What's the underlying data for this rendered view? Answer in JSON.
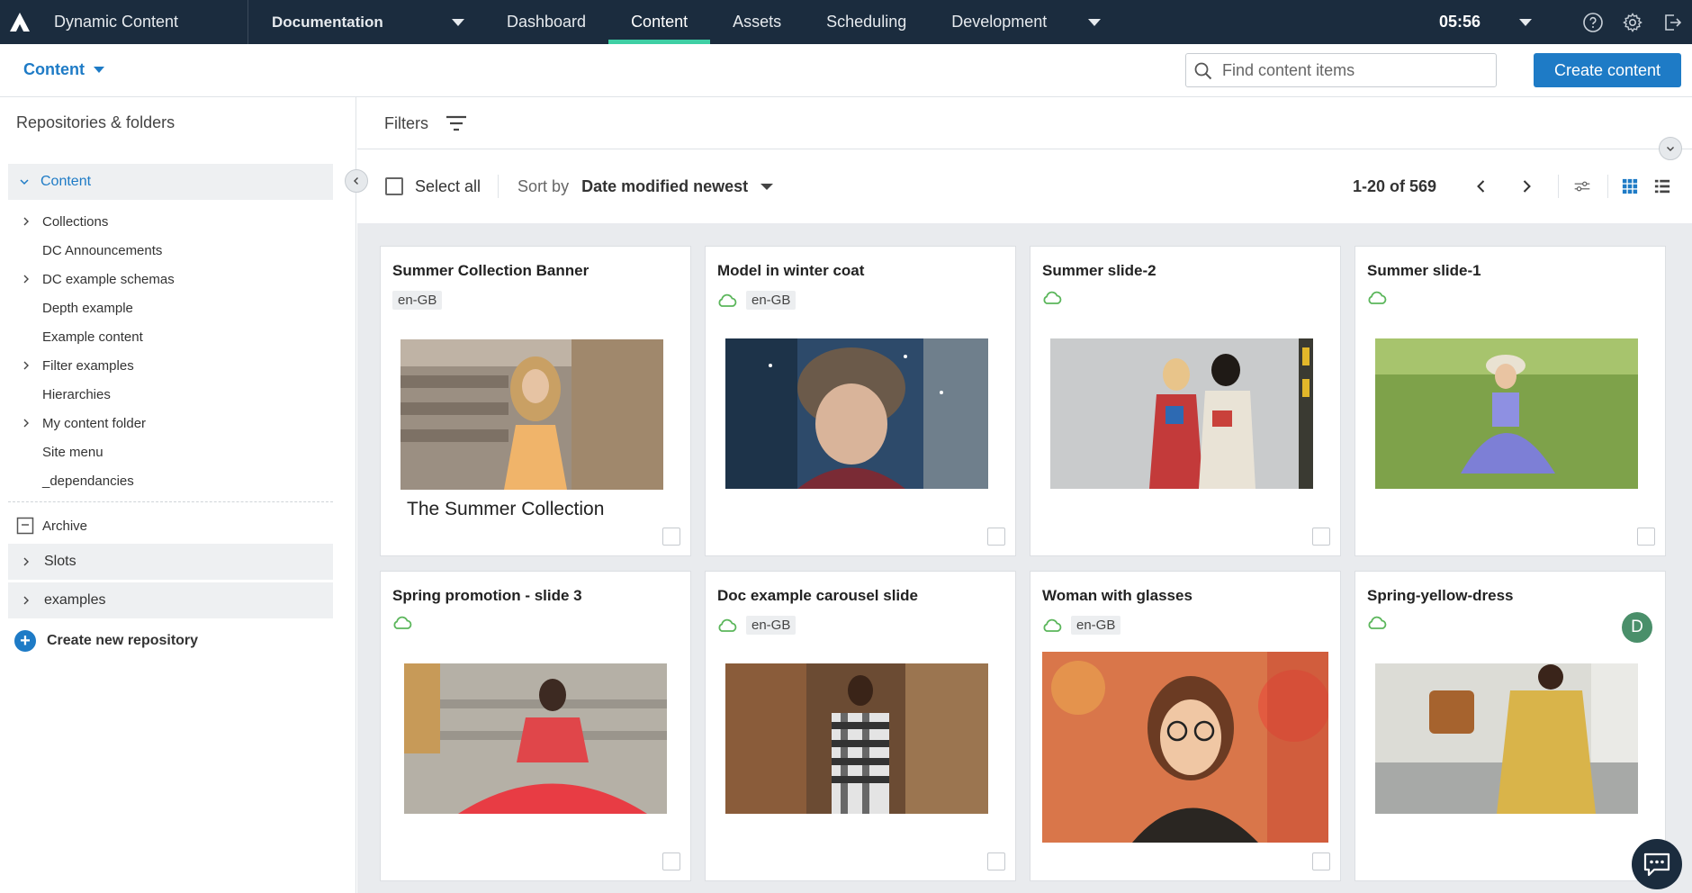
{
  "app": {
    "name": "Dynamic Content",
    "hub": "Documentation",
    "time": "05:56"
  },
  "nav": {
    "tabs": [
      {
        "label": "Dashboard"
      },
      {
        "label": "Content"
      },
      {
        "label": "Assets"
      },
      {
        "label": "Scheduling"
      },
      {
        "label": "Development"
      }
    ],
    "active_tab": "Content"
  },
  "subbar": {
    "breadcrumb": "Content",
    "search_placeholder": "Find content items",
    "create_label": "Create content"
  },
  "sidebar": {
    "title": "Repositories & folders",
    "repository": "Content",
    "folders": [
      {
        "label": "Collections",
        "expandable": true
      },
      {
        "label": "DC Announcements",
        "expandable": false
      },
      {
        "label": "DC example schemas",
        "expandable": true
      },
      {
        "label": "Depth example",
        "expandable": false
      },
      {
        "label": "Example content",
        "expandable": false
      },
      {
        "label": "Filter examples",
        "expandable": true
      },
      {
        "label": "Hierarchies",
        "expandable": false
      },
      {
        "label": "My content folder",
        "expandable": true
      },
      {
        "label": "Site menu",
        "expandable": false
      },
      {
        "label": "_dependancies",
        "expandable": false
      }
    ],
    "archive": "Archive",
    "other_repos": [
      {
        "label": "Slots"
      },
      {
        "label": "examples"
      }
    ],
    "create_repo": "Create new repository"
  },
  "main": {
    "filters_label": "Filters",
    "select_all": "Select all",
    "sort_by": "Sort by",
    "sort_value": "Date modified newest",
    "range": "1-20 of 569",
    "cards": [
      {
        "title": "Summer Collection Banner",
        "locale": "en-GB",
        "cloud": false,
        "text": "The Summer Collection",
        "image": "woman-stairs"
      },
      {
        "title": "Model in winter coat",
        "locale": "en-GB",
        "cloud": true,
        "text": "",
        "image": "winter-hat"
      },
      {
        "title": "Summer slide-2",
        "locale": "",
        "cloud": true,
        "text": "",
        "image": "two-friends"
      },
      {
        "title": "Summer slide-1",
        "locale": "",
        "cloud": true,
        "text": "",
        "image": "grass-dress"
      },
      {
        "title": "Spring promotion - slide 3",
        "locale": "",
        "cloud": true,
        "text": "",
        "image": "red-dress"
      },
      {
        "title": "Doc example carousel slide",
        "locale": "en-GB",
        "cloud": true,
        "text": "",
        "image": "gingham"
      },
      {
        "title": "Woman with glasses",
        "locale": "en-GB",
        "cloud": true,
        "text": "",
        "image": "glasses"
      },
      {
        "title": "Spring-yellow-dress",
        "locale": "",
        "cloud": true,
        "text": "",
        "image": "yellow-dress",
        "avatar": "D"
      }
    ]
  },
  "colors": {
    "topbar": "#1b2c3e",
    "accent": "#1e7bc6",
    "tab_indicator": "#3fcfa4",
    "cloud": "#5bb65b"
  }
}
